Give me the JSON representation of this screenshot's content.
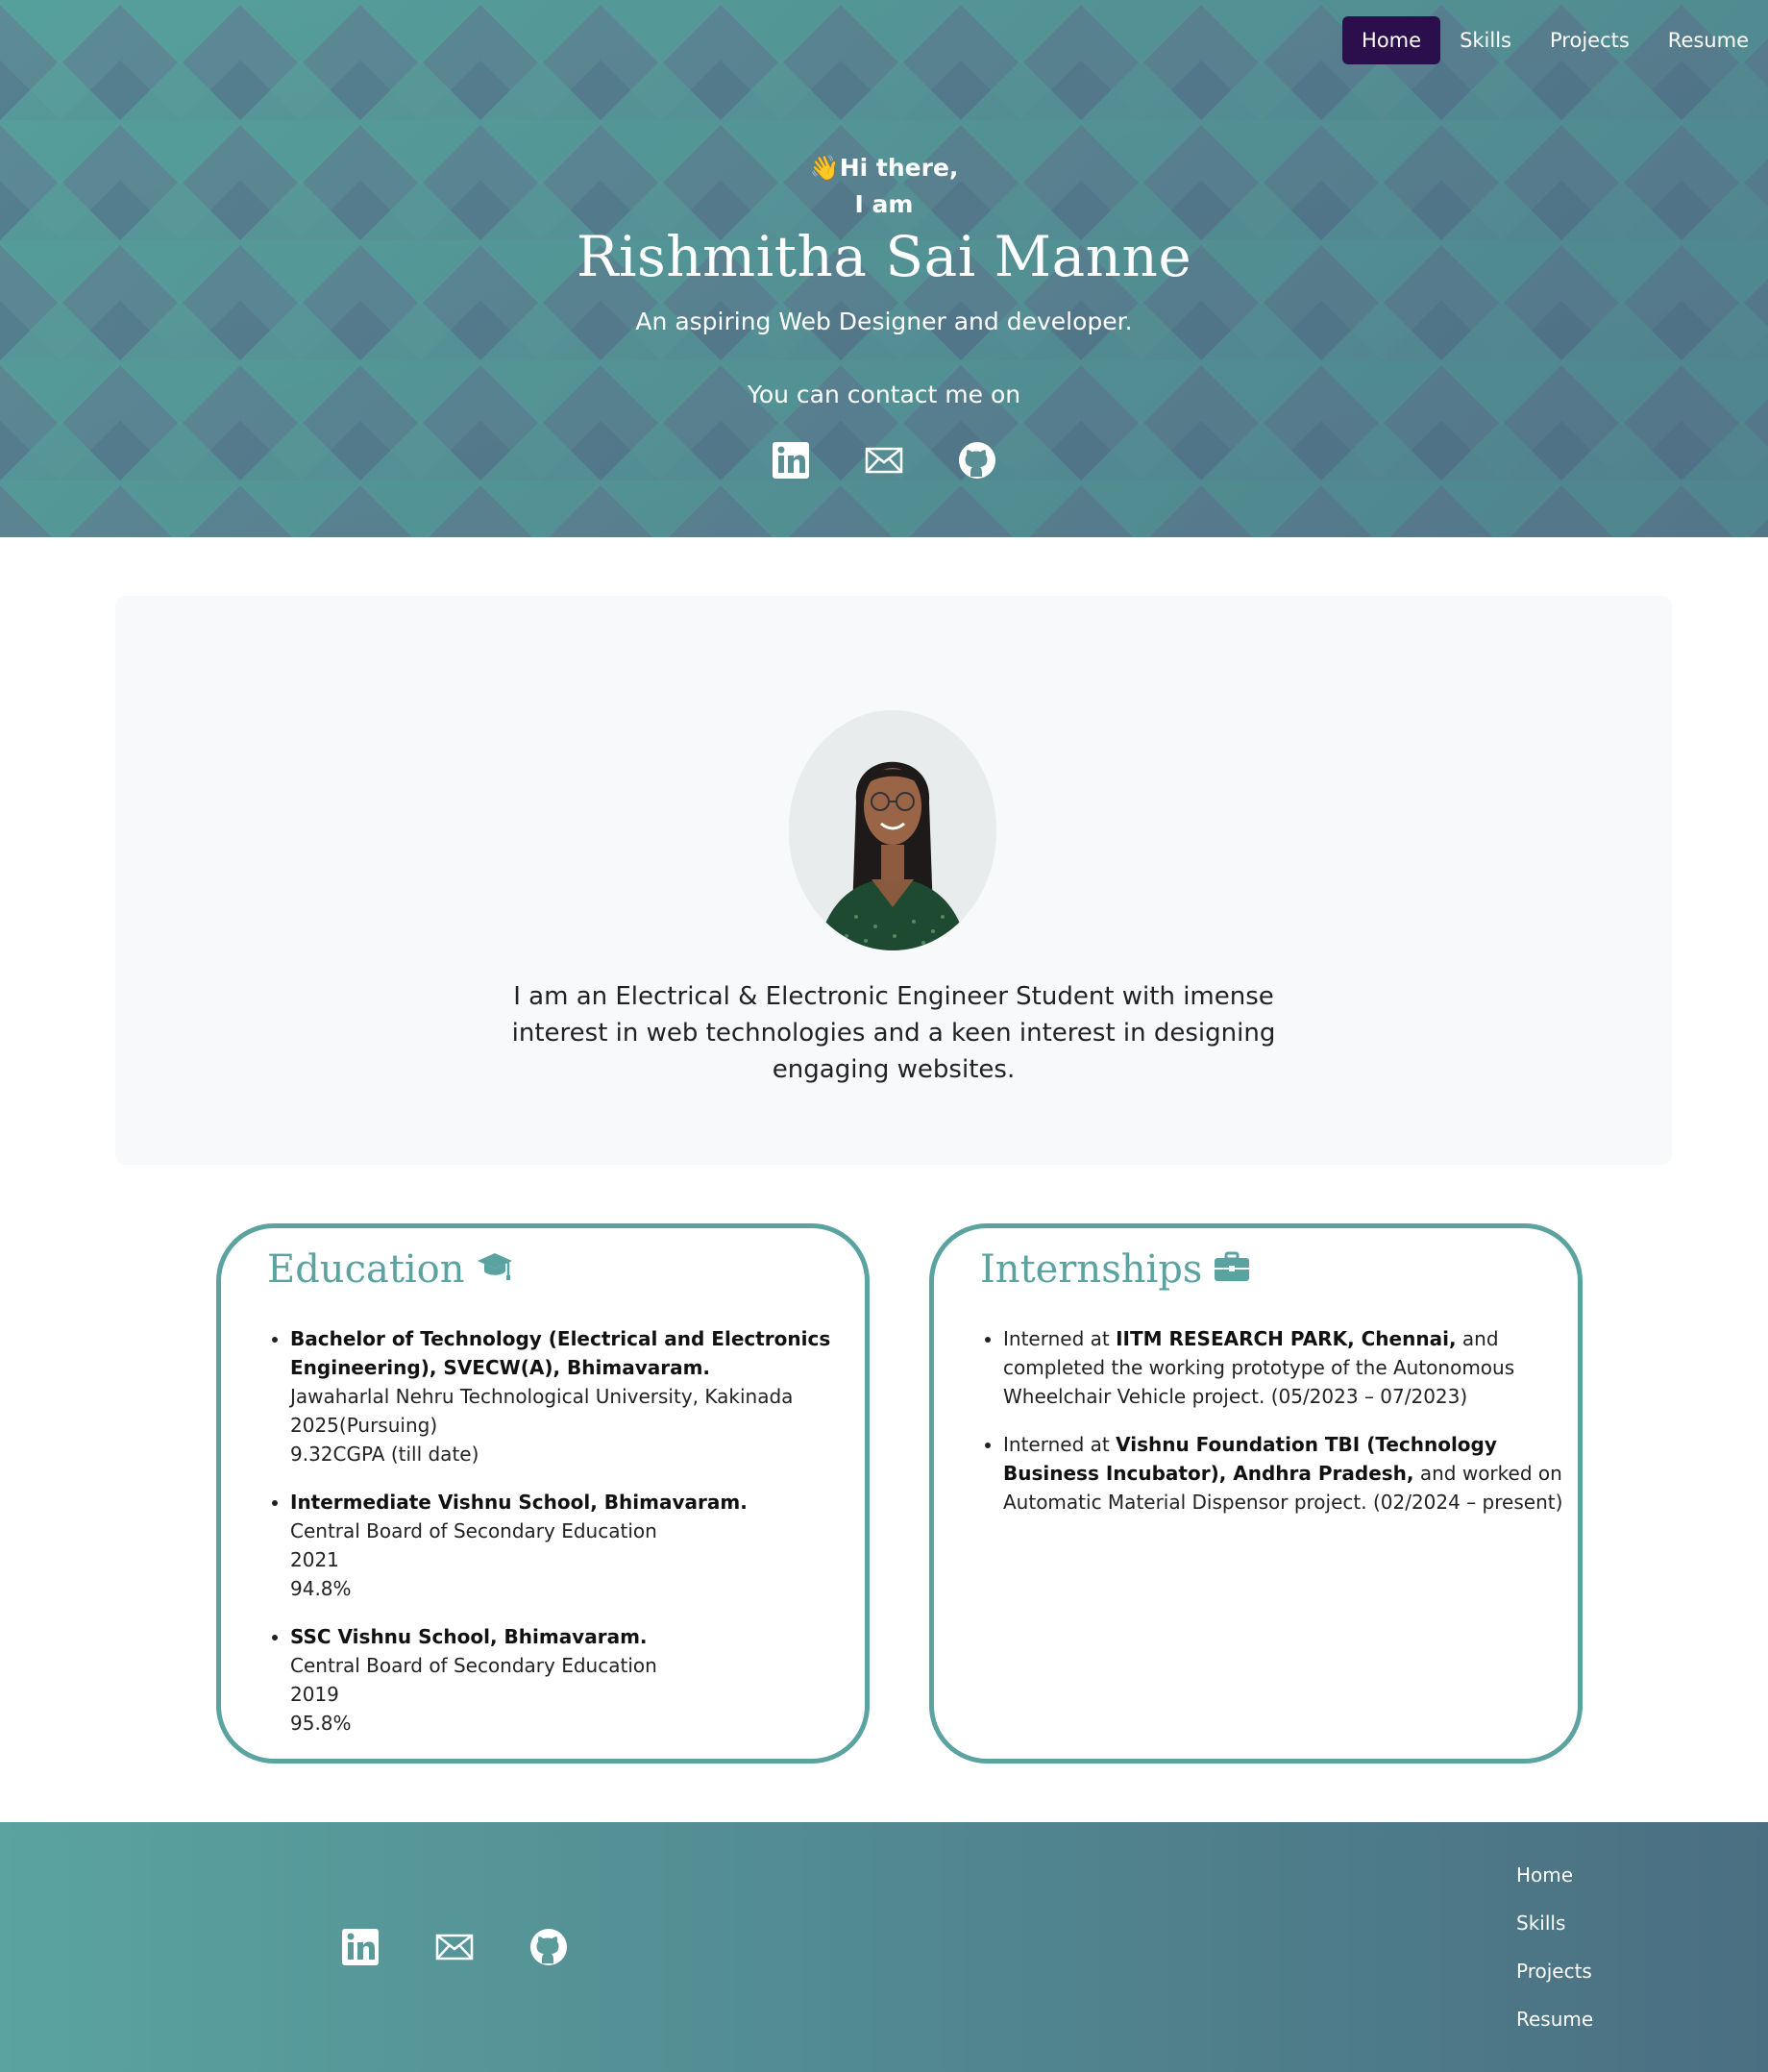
{
  "nav": {
    "items": [
      "Home",
      "Skills",
      "Projects",
      "Resume"
    ],
    "active": "Home"
  },
  "hero": {
    "wave_emoji": "👋",
    "greeting": "Hi there,",
    "iam": "I am",
    "name": "Rishmitha Sai Manne",
    "tagline": "An aspiring Web Designer and developer.",
    "contact_text": "You can contact me on",
    "icons": [
      "linkedin-icon",
      "mail-icon",
      "github-icon"
    ]
  },
  "about": {
    "text": "I am an Electrical & Electronic Engineer Student with imense interest in web technologies and a keen interest in designing engaging websites."
  },
  "education": {
    "title": "Education",
    "icon": "graduation-cap-icon",
    "items": [
      {
        "heading": "Bachelor of Technology (Electrical and Electronics Engineering), SVECW(A), Bhimavaram.",
        "lines": [
          "Jawaharlal Nehru Technological University, Kakinada",
          "2025(Pursuing)",
          "9.32CGPA (till date)"
        ]
      },
      {
        "heading": "Intermediate Vishnu School, Bhimavaram.",
        "lines": [
          "Central Board of Secondary Education",
          "2021",
          "94.8%"
        ]
      },
      {
        "heading": "SSC Vishnu School, Bhimavaram.",
        "lines": [
          "Central Board of Secondary Education",
          "2019",
          "95.8%"
        ]
      }
    ]
  },
  "internships": {
    "title": "Internships",
    "icon": "briefcase-icon",
    "items": [
      {
        "prefix": "Interned at ",
        "org": "IITM RESEARCH PARK, Chennai,",
        "rest": " and completed the working prototype of the Autonomous Wheelchair Vehicle project. (05/2023 – 07/2023)"
      },
      {
        "prefix": "Interned at ",
        "org": "Vishnu Foundation TBI (Technology Business Incubator), Andhra Pradesh,",
        "rest": " and worked on Automatic Material Dispensor project. (02/2024 – present)"
      }
    ]
  },
  "footer": {
    "icons": [
      "linkedin-icon",
      "mail-icon",
      "github-icon"
    ],
    "links": [
      "Home",
      "Skills",
      "Projects",
      "Resume"
    ]
  },
  "colors": {
    "teal": "#5aa3a0",
    "slate": "#4a6f82",
    "nav_active": "#2a0f4c"
  }
}
